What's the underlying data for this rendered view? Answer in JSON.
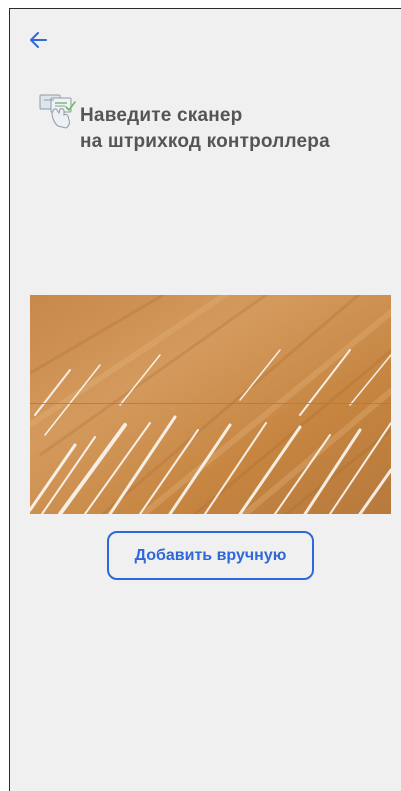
{
  "header": {
    "back_icon": "arrow-left-icon",
    "scanner_icon": "barcode-scan-icon",
    "instruction_line1": "Наведите сканер",
    "instruction_line2": "на штрихкод контроллера"
  },
  "actions": {
    "manual_add_label": "Добавить вручную"
  },
  "colors": {
    "accent": "#2f68d8",
    "text": "#555555",
    "background": "#f0f0f0"
  }
}
